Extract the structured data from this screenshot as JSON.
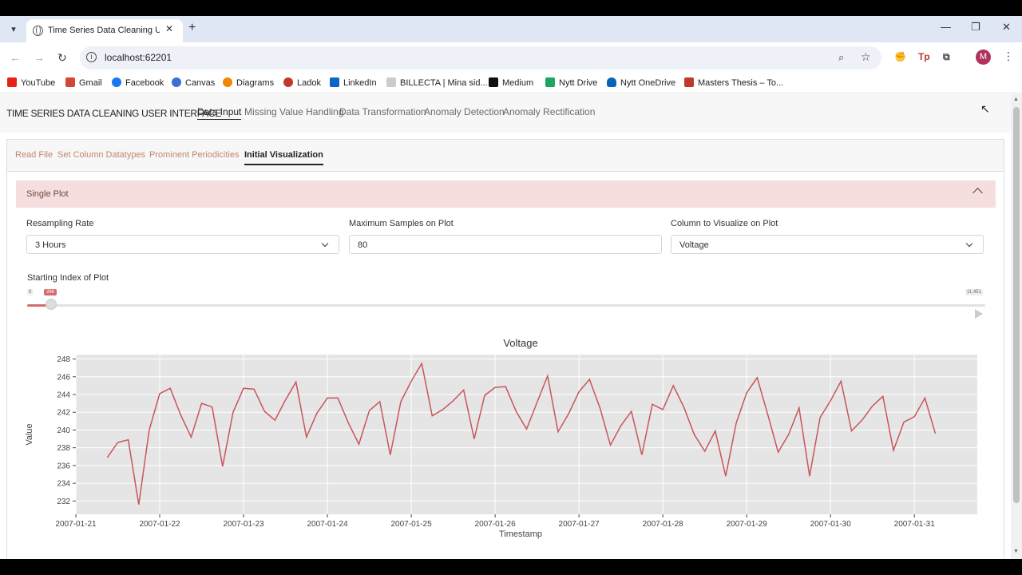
{
  "browser": {
    "tab_title": "Time Series Data Cleaning User Interface",
    "url": "localhost:62201",
    "avatar_initial": "M"
  },
  "bookmarks": [
    {
      "label": "YouTube",
      "color": "#e62117"
    },
    {
      "label": "Gmail",
      "color": "#d44638"
    },
    {
      "label": "Facebook",
      "color": "#1877f2"
    },
    {
      "label": "Canvas",
      "color": "#3b6fd6"
    },
    {
      "label": "Diagrams",
      "color": "#f08705"
    },
    {
      "label": "Ladok",
      "color": "#c0392b"
    },
    {
      "label": "LinkedIn",
      "color": "#0a66c2"
    },
    {
      "label": "BILLECTA | Mina sid...",
      "color": "#cccccc"
    },
    {
      "label": "Medium",
      "color": "#111111"
    },
    {
      "label": "Nytt Drive",
      "color": "#1fa463"
    },
    {
      "label": "Nytt OneDrive",
      "color": "#0364b8"
    },
    {
      "label": "Masters Thesis – To...",
      "color": "#c0392b"
    }
  ],
  "app": {
    "brand": "TIME SERIES DATA CLEANING USER INTERFACE",
    "nav": [
      "Data Input",
      "Missing Value Handling",
      "Data Transformation",
      "Anomaly Detection",
      "Anomaly Rectification"
    ],
    "subtabs": [
      "Read File",
      "Set Column Datatypes",
      "Prominent Periodicities",
      "Initial Visualization"
    ],
    "accordion_title": "Single Plot",
    "fields": {
      "resampling_label": "Resampling Rate",
      "resampling_value": "3 Hours",
      "max_samples_label": "Maximum Samples on Plot",
      "max_samples_value": "80",
      "column_label": "Column to Visualize on Plot",
      "column_value": "Voltage"
    },
    "slider": {
      "label": "Starting Index of Plot",
      "min": "0",
      "max": "11,451",
      "value": "286",
      "fraction": 0.025
    }
  },
  "chart_data": {
    "type": "line",
    "title": "Voltage",
    "xlabel": "Timestamp",
    "ylabel": "Value",
    "ylim": [
      230.5,
      248.5
    ],
    "yticks": [
      232,
      234,
      236,
      238,
      240,
      242,
      244,
      246,
      248
    ],
    "xticks": [
      "2007-01-21",
      "2007-01-22",
      "2007-01-23",
      "2007-01-24",
      "2007-01-25",
      "2007-01-26",
      "2007-01-27",
      "2007-01-28",
      "2007-01-29",
      "2007-01-30",
      "2007-01-31"
    ],
    "x_start": "2007-01-21 00:00",
    "x_end": "2007-01-31 18:00",
    "line_color": "#c9555b",
    "grid": true,
    "series": [
      {
        "x": [
          "2007-01-21 09:00",
          "2007-01-21 12:00",
          "2007-01-21 15:00",
          "2007-01-21 18:00",
          "2007-01-21 21:00",
          "2007-01-22 00:00",
          "2007-01-22 03:00",
          "2007-01-22 06:00",
          "2007-01-22 09:00",
          "2007-01-22 12:00",
          "2007-01-22 15:00",
          "2007-01-22 18:00",
          "2007-01-22 21:00",
          "2007-01-23 00:00",
          "2007-01-23 03:00",
          "2007-01-23 06:00",
          "2007-01-23 09:00",
          "2007-01-23 12:00",
          "2007-01-23 15:00",
          "2007-01-23 18:00",
          "2007-01-23 21:00",
          "2007-01-24 00:00",
          "2007-01-24 03:00",
          "2007-01-24 06:00",
          "2007-01-24 09:00",
          "2007-01-24 12:00",
          "2007-01-24 15:00",
          "2007-01-24 18:00",
          "2007-01-24 21:00",
          "2007-01-25 00:00",
          "2007-01-25 03:00",
          "2007-01-25 06:00",
          "2007-01-25 09:00",
          "2007-01-25 12:00",
          "2007-01-25 15:00",
          "2007-01-25 18:00",
          "2007-01-25 21:00",
          "2007-01-26 00:00",
          "2007-01-26 03:00",
          "2007-01-26 06:00",
          "2007-01-26 09:00",
          "2007-01-26 12:00",
          "2007-01-26 15:00",
          "2007-01-26 18:00",
          "2007-01-26 21:00",
          "2007-01-27 00:00",
          "2007-01-27 03:00",
          "2007-01-27 06:00",
          "2007-01-27 09:00",
          "2007-01-27 12:00",
          "2007-01-27 15:00",
          "2007-01-27 18:00",
          "2007-01-27 21:00",
          "2007-01-28 00:00",
          "2007-01-28 03:00",
          "2007-01-28 06:00",
          "2007-01-28 09:00",
          "2007-01-28 12:00",
          "2007-01-28 15:00",
          "2007-01-28 18:00",
          "2007-01-28 21:00",
          "2007-01-29 00:00",
          "2007-01-29 03:00",
          "2007-01-29 06:00",
          "2007-01-29 09:00",
          "2007-01-29 12:00",
          "2007-01-29 15:00",
          "2007-01-29 18:00",
          "2007-01-29 21:00",
          "2007-01-30 00:00",
          "2007-01-30 03:00",
          "2007-01-30 06:00",
          "2007-01-30 09:00",
          "2007-01-30 12:00",
          "2007-01-30 15:00",
          "2007-01-30 18:00",
          "2007-01-30 21:00",
          "2007-01-31 00:00",
          "2007-01-31 03:00",
          "2007-01-31 06:00"
        ],
        "values": [
          236.9,
          238.6,
          238.9,
          231.6,
          240.0,
          244.1,
          244.7,
          241.7,
          239.2,
          243.0,
          242.6,
          235.9,
          242.0,
          244.7,
          244.6,
          242.1,
          241.1,
          243.4,
          245.4,
          239.2,
          241.9,
          243.6,
          243.6,
          240.8,
          238.4,
          242.2,
          243.2,
          237.2,
          243.2,
          245.5,
          247.5,
          241.6,
          242.3,
          243.3,
          244.5,
          239.0,
          243.9,
          244.8,
          244.9,
          242.1,
          240.1,
          243.1,
          246.1,
          239.8,
          241.8,
          244.3,
          245.7,
          242.5,
          238.3,
          240.5,
          242.1,
          237.2,
          242.9,
          242.3,
          245.0,
          242.6,
          239.5,
          237.6,
          239.9,
          234.8,
          240.8,
          244.2,
          245.9,
          241.8,
          237.5,
          239.5,
          242.5,
          234.8,
          241.4,
          243.3,
          245.5,
          239.9,
          241.1,
          242.7,
          243.8,
          237.7,
          240.9,
          241.5,
          243.6,
          239.6
        ]
      }
    ]
  }
}
